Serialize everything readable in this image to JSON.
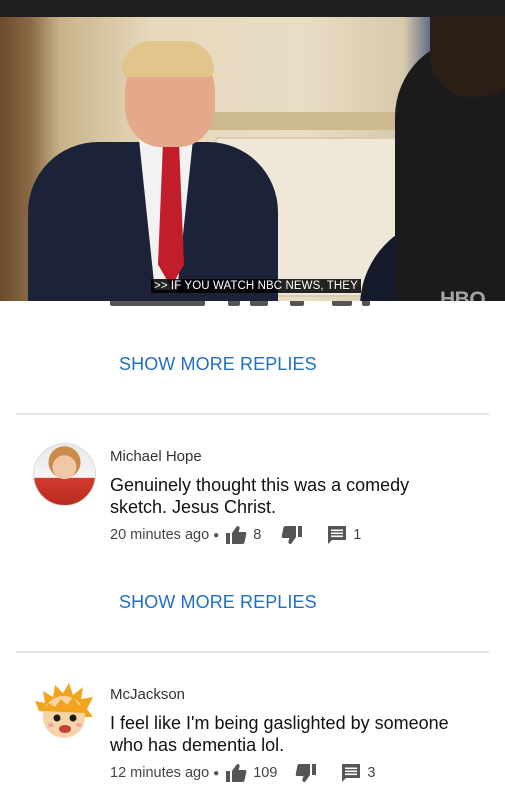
{
  "video": {
    "caption": ">> IF YOU WATCH NBC NEWS, THEY",
    "watermark": "HBO"
  },
  "replies_link_label": "SHOW MORE REPLIES",
  "comments": [
    {
      "author": "Michael Hope",
      "text": "Genuinely thought this was a comedy sketch. Jesus Christ.",
      "time": "20 minutes ago",
      "likes": "8",
      "replies": "1",
      "avatar": "user-photo"
    },
    {
      "author": "McJackson",
      "text": "I feel like I'm being gaslighted by someone who has dementia lol.",
      "time": "12 minutes ago",
      "likes": "109",
      "replies": "3",
      "avatar": "cartoon-character"
    }
  ],
  "colors": {
    "link": "#1f6fc5",
    "divider": "#e4e4e4",
    "icon": "#555555"
  }
}
